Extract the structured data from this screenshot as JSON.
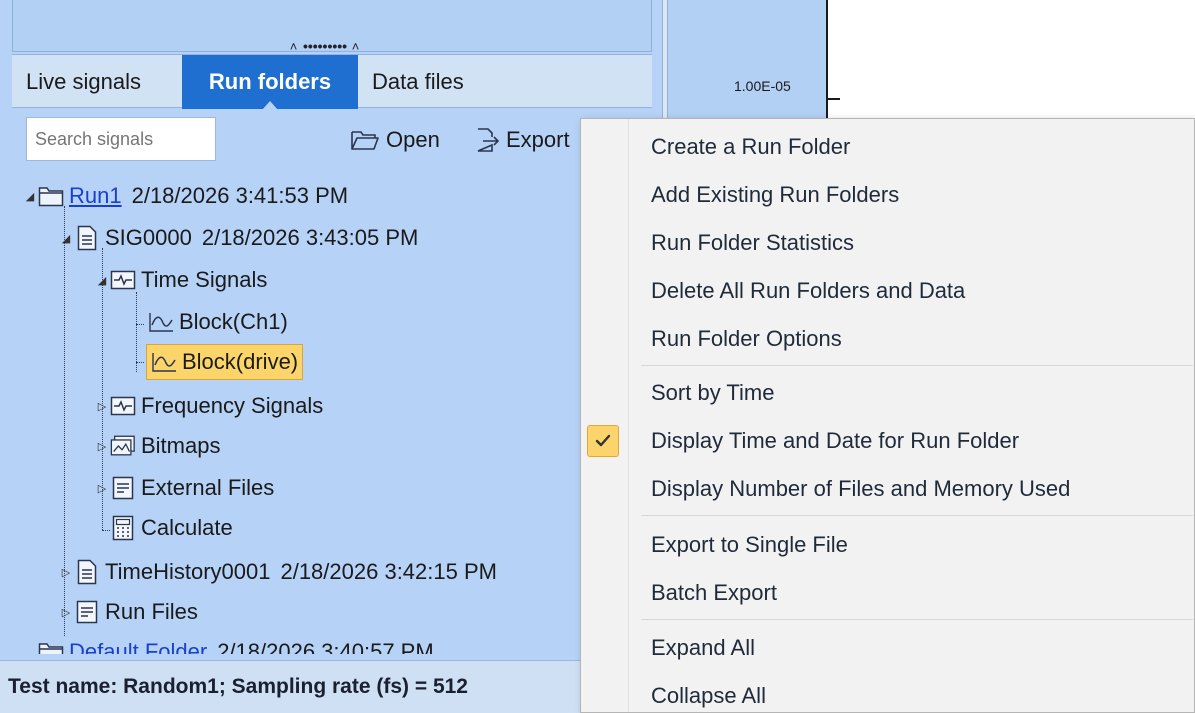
{
  "tabs": [
    {
      "label": "Live signals"
    },
    {
      "label": "Run folders"
    },
    {
      "label": "Data files"
    }
  ],
  "search": {
    "placeholder": "Search signals"
  },
  "toolbar": {
    "open_label": "Open",
    "export_label": "Export"
  },
  "tree": {
    "run1": {
      "name": "Run1",
      "timestamp": "2/18/2026 3:41:53 PM"
    },
    "sig0000": {
      "name": "SIG0000",
      "timestamp": "2/18/2026 3:43:05 PM"
    },
    "time_signals": "Time Signals",
    "block_ch1": "Block(Ch1)",
    "block_drive": "Block(drive)",
    "frequency_signals": "Frequency Signals",
    "bitmaps": "Bitmaps",
    "external_files": "External Files",
    "calculate": "Calculate",
    "timehistory": {
      "name": "TimeHistory0001",
      "timestamp": "2/18/2026 3:42:15 PM"
    },
    "run_files": "Run Files",
    "default_folder": {
      "name": "Default Folder",
      "timestamp": "2/18/2026 3:40:57 PM"
    }
  },
  "status": {
    "text": "Test name: Random1; Sampling rate (fs) = 512"
  },
  "plot": {
    "axis_label": "1.00E-05"
  },
  "context_menu": {
    "items": [
      {
        "label": "Create a Run Folder"
      },
      {
        "label": "Add Existing Run Folders"
      },
      {
        "label": "Run Folder Statistics"
      },
      {
        "label": "Delete All Run Folders and Data"
      },
      {
        "label": "Run Folder Options"
      },
      {
        "label": "Sort by Time"
      },
      {
        "label": "Display Time and Date for Run Folder",
        "checked": true
      },
      {
        "label": "Display Number of Files and Memory Used"
      },
      {
        "label": "Export to Single File"
      },
      {
        "label": "Batch Export"
      },
      {
        "label": "Expand All"
      },
      {
        "label": "Collapse All"
      }
    ]
  },
  "colors": {
    "panel_bg": "#b6d3f7",
    "active_tab": "#1f6fd1",
    "selection": "#fcd56a",
    "link": "#1a3fcf",
    "menu_bg": "#f2f2f2"
  }
}
